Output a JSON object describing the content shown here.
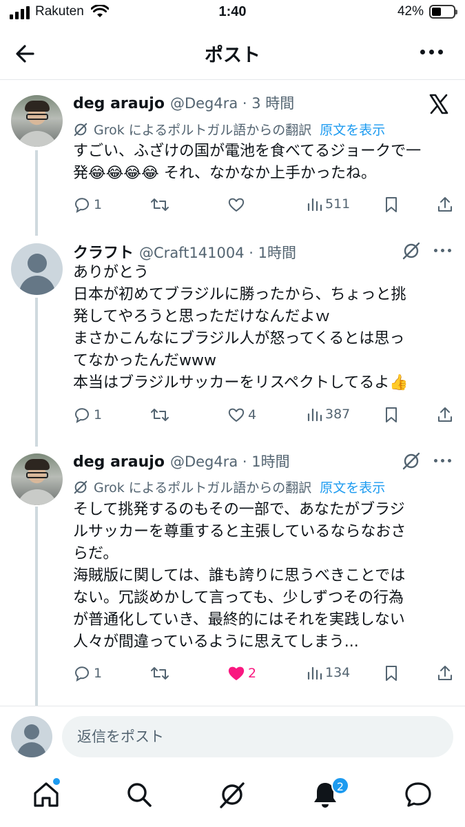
{
  "status_bar": {
    "carrier": "Rakuten",
    "time": "1:40",
    "battery_percent": "42%",
    "battery_level": 0.42
  },
  "header": {
    "title": "ポスト",
    "back_icon": "arrow-left-icon",
    "more_icon": "more-horizontal-icon"
  },
  "tweets": [
    {
      "name": "deg araujo",
      "meta": "@Deg4ra · 3 時間",
      "translation_note": "Grok によるポルトガル語からの翻訳",
      "show_original": "原文を表示",
      "lines": [
        "すごい、ふざけの国が電池を食べてるジョークで一",
        "発😂😂😂😂 それ、なかなか上手かったね。"
      ],
      "replies": "1",
      "retweets": "",
      "likes": "",
      "views": "511",
      "liked": false
    },
    {
      "name": "クラフト",
      "meta": "@Craft141004 · 1時間",
      "lines": [
        "ありがとう",
        "日本が初めてブラジルに勝ったから、ちょっと挑",
        "発してやろうと思っただけなんだよｗ",
        "まさかこんなにブラジル人が怒ってくるとは思っ",
        "てなかったんだwww",
        "本当はブラジルサッカーをリスペクトしてるよ👍"
      ],
      "replies": "1",
      "retweets": "",
      "likes": "4",
      "views": "387",
      "liked": false
    },
    {
      "name": "deg araujo",
      "meta": "@Deg4ra · 1時間",
      "translation_note": "Grok によるポルトガル語からの翻訳",
      "show_original": "原文を表示",
      "lines": [
        "そして挑発するのもその一部で、あなたがブラジ",
        "ルサッカーを尊重すると主張しているならなおさ",
        "らだ。",
        "海賊版に関しては、誰も誇りに思うべきことでは",
        "ない。冗談めかして言っても、少しずつその行為",
        "が普通化していき、最終的にはそれを実践しない",
        "人々が間違っているように思えてしまう..."
      ],
      "replies": "1",
      "retweets": "",
      "likes": "2",
      "views": "134",
      "liked": true
    }
  ],
  "composer": {
    "placeholder": "返信をポスト"
  },
  "bottom_nav": {
    "items": [
      "home-icon",
      "search-icon",
      "grok-icon",
      "notifications-icon",
      "messages-icon"
    ],
    "notifications_badge": "2"
  },
  "colors": {
    "accent": "#1d9bf0",
    "like": "#f91880",
    "secondary_text": "#536471"
  }
}
